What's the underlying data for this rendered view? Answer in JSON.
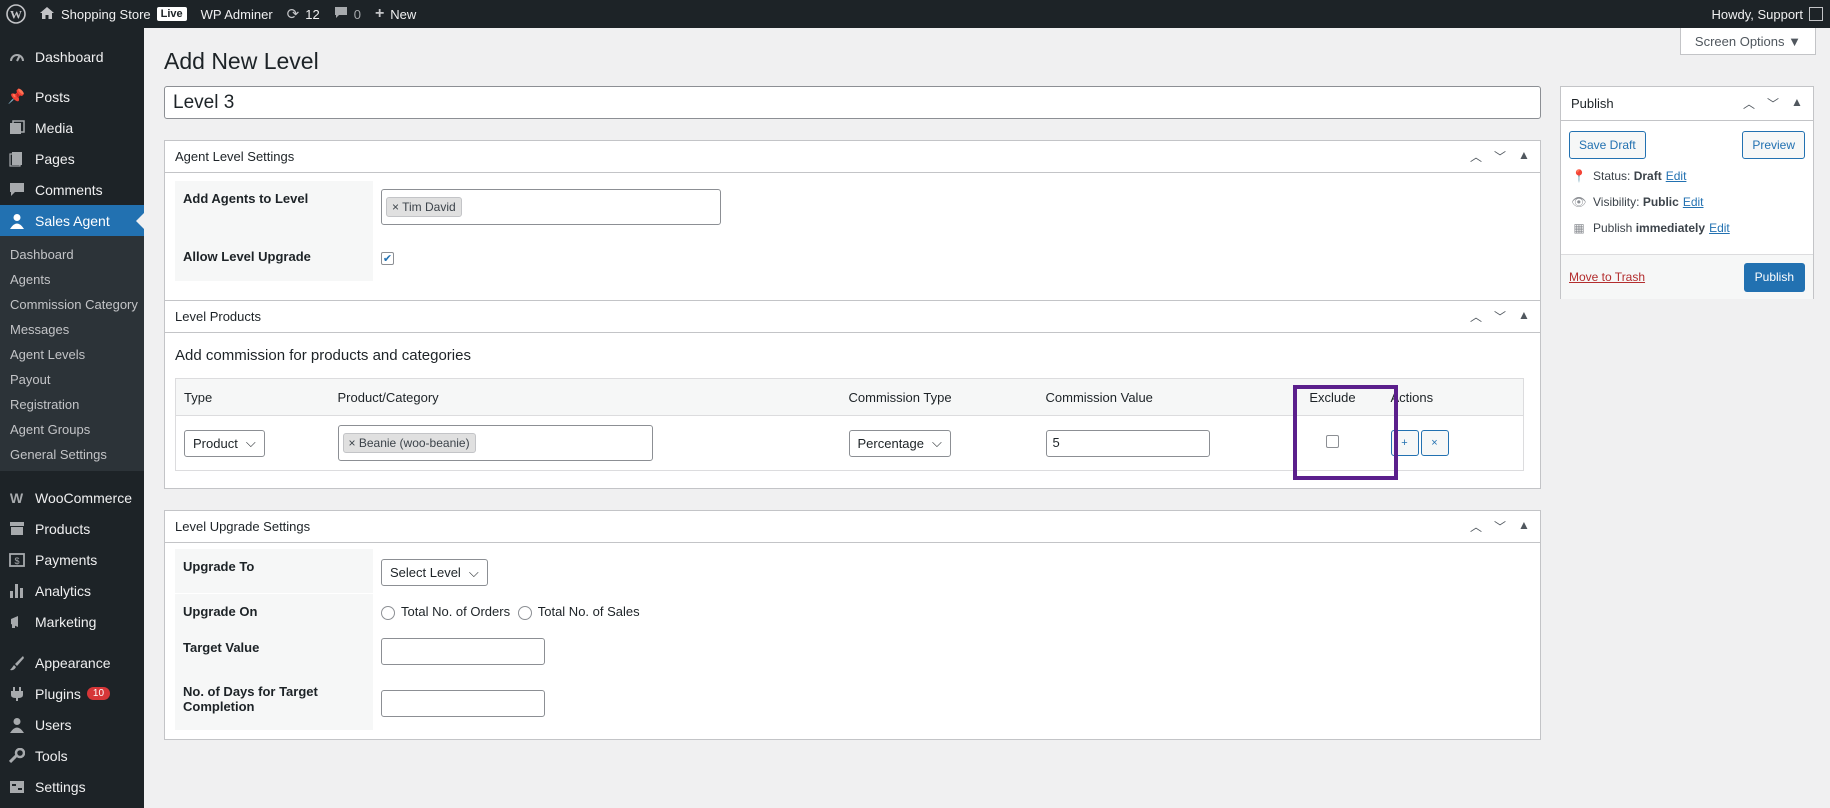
{
  "admin_bar": {
    "site_name": "Shopping Store",
    "live_label": "Live",
    "user_link": "WP Adminer",
    "updates_count": "12",
    "comments_count": "0",
    "new_label": "New",
    "howdy": "Howdy, Support"
  },
  "sidebar": {
    "dashboard": "Dashboard",
    "posts": "Posts",
    "media": "Media",
    "pages": "Pages",
    "comments": "Comments",
    "sales_agent": "Sales Agent",
    "sub": [
      "Dashboard",
      "Agents",
      "Commission Category",
      "Messages",
      "Agent Levels",
      "Payout",
      "Registration",
      "Agent Groups",
      "General Settings"
    ],
    "woocommerce": "WooCommerce",
    "products": "Products",
    "payments": "Payments",
    "analytics": "Analytics",
    "marketing": "Marketing",
    "appearance": "Appearance",
    "plugins": "Plugins",
    "plugins_badge": "10",
    "users": "Users",
    "tools": "Tools",
    "settings": "Settings"
  },
  "screen_options": "Screen Options ▼",
  "page_title": "Add New Level",
  "level_title": "Level 3",
  "agent_settings": {
    "title": "Agent Level Settings",
    "add_agents_label": "Add Agents to Level",
    "agent_token": "Tim David",
    "allow_upgrade_label": "Allow Level Upgrade",
    "allow_upgrade_checked": true
  },
  "level_products": {
    "title": "Level Products",
    "subtitle": "Add commission for products and categories",
    "headers": [
      "Type",
      "Product/Category",
      "Commission Type",
      "Commission Value",
      "Exclude",
      "Actions"
    ],
    "row": {
      "type": "Product",
      "product": "Beanie (woo-beanie)",
      "commission_type": "Percentage",
      "commission_value": "5",
      "exclude": false
    }
  },
  "upgrade_settings": {
    "title": "Level Upgrade Settings",
    "upgrade_to_label": "Upgrade To",
    "upgrade_to_value": "Select Level",
    "upgrade_on_label": "Upgrade On",
    "opt_orders": "Total No. of Orders",
    "opt_sales": "Total No. of Sales",
    "target_value_label": "Target Value",
    "days_label_1": "No. of Days for Target",
    "days_label_2": "Completion"
  },
  "publish": {
    "title": "Publish",
    "save_draft": "Save Draft",
    "preview": "Preview",
    "status_label": "Status:",
    "status_value": "Draft",
    "visibility_label": "Visibility:",
    "visibility_value": "Public",
    "publish_label": "Publish",
    "publish_value": "immediately",
    "edit": "Edit",
    "trash": "Move to Trash",
    "publish_button": "Publish"
  },
  "colors": {
    "accent": "#2271b1",
    "highlight": "#5b1f8c",
    "bar": "#1d2327"
  }
}
